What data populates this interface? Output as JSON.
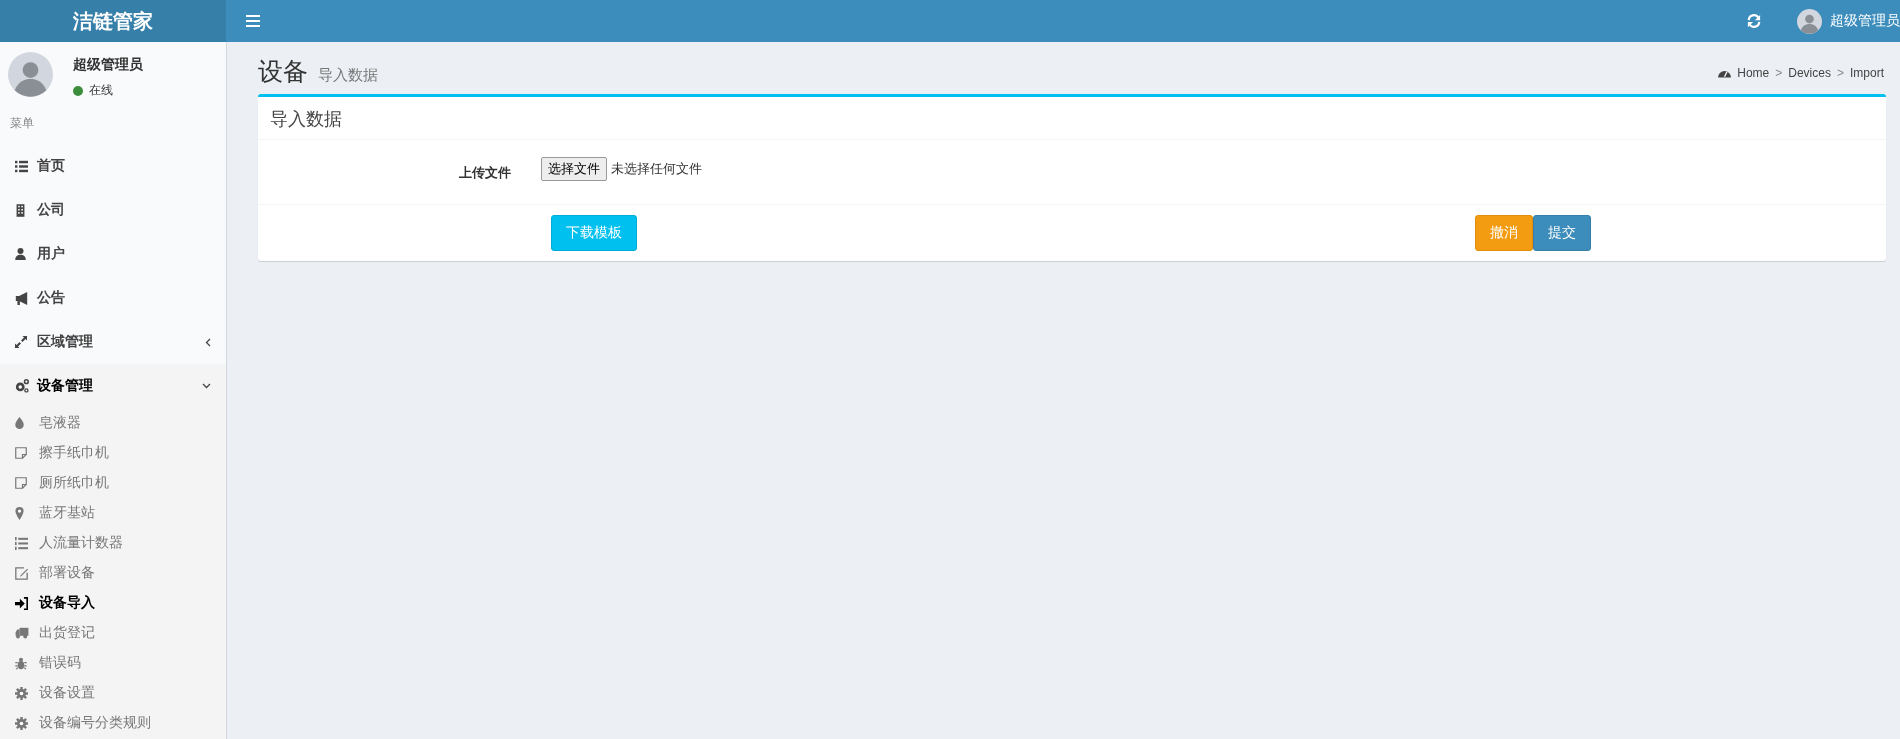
{
  "header": {
    "logo": "洁链管家",
    "user_name": "超级管理员"
  },
  "sidebar": {
    "user": {
      "name": "超级管理员",
      "status": "在线"
    },
    "menu_header": "菜单",
    "items": [
      {
        "label": "首页",
        "selected": false
      },
      {
        "label": "公司",
        "selected": false
      },
      {
        "label": "用户",
        "selected": false
      },
      {
        "label": "公告",
        "selected": false
      },
      {
        "label": "区域管理",
        "selected": false,
        "expanded": false
      },
      {
        "label": "设备管理",
        "selected": true,
        "expanded": true,
        "children": [
          {
            "label": "皂液器",
            "selected": false
          },
          {
            "label": "擦手纸巾机",
            "selected": false
          },
          {
            "label": "厕所纸巾机",
            "selected": false
          },
          {
            "label": "蓝牙基站",
            "selected": false
          },
          {
            "label": "人流量计数器",
            "selected": false
          },
          {
            "label": "部署设备",
            "selected": false
          },
          {
            "label": "设备导入",
            "selected": true
          },
          {
            "label": "出货登记",
            "selected": false
          },
          {
            "label": "错误码",
            "selected": false
          },
          {
            "label": "设备设置",
            "selected": false
          },
          {
            "label": "设备编号分类规则",
            "selected": false
          }
        ]
      }
    ]
  },
  "page": {
    "title": "设备",
    "subtitle": "导入数据",
    "breadcrumb": [
      {
        "kind": "link",
        "text": "Home"
      },
      {
        "kind": "separator",
        "text": ">"
      },
      {
        "kind": "link",
        "text": "Devices"
      },
      {
        "kind": "separator",
        "text": ">"
      },
      {
        "kind": "current",
        "text": "Import"
      }
    ]
  },
  "box": {
    "title": "导入数据",
    "upload_label": "上传文件",
    "file_button": "选择文件",
    "file_status": "未选择任何文件",
    "download_button": "下载模板",
    "cancel_button": "撤消",
    "submit_button": "提交"
  }
}
